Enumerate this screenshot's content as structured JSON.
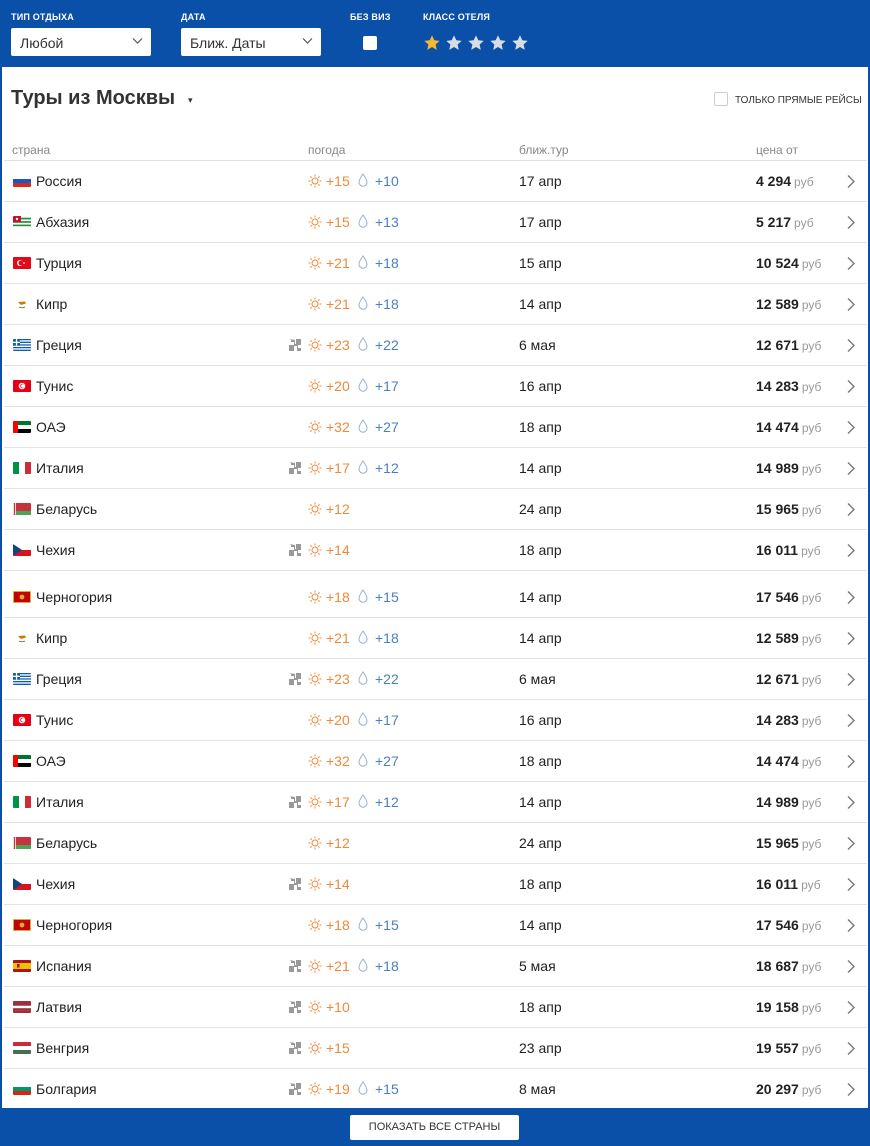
{
  "filters": {
    "type_label": "ТИП ОТДЫХА",
    "type_value": "Любой",
    "date_label": "ДАТА",
    "date_value": "Ближ. Даты",
    "novisa_label": "БЕЗ ВИЗ",
    "hotel_class_label": "КЛАСС ОТЕЛЯ",
    "hotel_stars_selected": 1,
    "hotel_stars_total": 5,
    "star_active_color": "#f5b82e",
    "star_inactive_color": "#d9dde3"
  },
  "header": {
    "title": "Туры из Москвы",
    "caret": "▾",
    "direct_flights_label": "ТОЛЬКО ПРЯМЫЕ РЕЙСЫ"
  },
  "table": {
    "columns": {
      "country": "страна",
      "weather": "погода",
      "nearest": "ближ.тур",
      "price": "цена от"
    },
    "currency": "руб",
    "rows": [
      {
        "country": "Россия",
        "flag": "ru",
        "visa": false,
        "air": "+15",
        "water": "+10",
        "date": "17 апр",
        "price": "4 294"
      },
      {
        "country": "Абхазия",
        "flag": "abkhazia",
        "visa": false,
        "air": "+15",
        "water": "+13",
        "date": "17 апр",
        "price": "5 217"
      },
      {
        "country": "Турция",
        "flag": "tr",
        "visa": false,
        "air": "+21",
        "water": "+18",
        "date": "15 апр",
        "price": "10 524"
      },
      {
        "country": "Кипр",
        "flag": "cy",
        "visa": false,
        "air": "+21",
        "water": "+18",
        "date": "14 апр",
        "price": "12 589"
      },
      {
        "country": "Греция",
        "flag": "gr",
        "visa": true,
        "air": "+23",
        "water": "+22",
        "date": "6 мая",
        "price": "12 671"
      },
      {
        "country": "Тунис",
        "flag": "tn",
        "visa": false,
        "air": "+20",
        "water": "+17",
        "date": "16 апр",
        "price": "14 283"
      },
      {
        "country": "ОАЭ",
        "flag": "ae",
        "visa": false,
        "air": "+32",
        "water": "+27",
        "date": "18 апр",
        "price": "14 474"
      },
      {
        "country": "Италия",
        "flag": "it",
        "visa": true,
        "air": "+17",
        "water": "+12",
        "date": "14 апр",
        "price": "14 989"
      },
      {
        "country": "Беларусь",
        "flag": "by",
        "visa": false,
        "air": "+12",
        "water": "",
        "date": "24 апр",
        "price": "15 965"
      },
      {
        "country": "Чехия",
        "flag": "cz",
        "visa": true,
        "air": "+14",
        "water": "",
        "date": "18 апр",
        "price": "16 011"
      },
      {
        "country": "Черногория",
        "flag": "me",
        "visa": false,
        "air": "+18",
        "water": "+15",
        "date": "14 апр",
        "price": "17 546",
        "tall": true
      },
      {
        "country": "Кипр",
        "flag": "cy",
        "visa": false,
        "air": "+21",
        "water": "+18",
        "date": "14 апр",
        "price": "12 589"
      },
      {
        "country": "Греция",
        "flag": "gr",
        "visa": true,
        "air": "+23",
        "water": "+22",
        "date": "6 мая",
        "price": "12 671"
      },
      {
        "country": "Тунис",
        "flag": "tn",
        "visa": false,
        "air": "+20",
        "water": "+17",
        "date": "16 апр",
        "price": "14 283"
      },
      {
        "country": "ОАЭ",
        "flag": "ae",
        "visa": false,
        "air": "+32",
        "water": "+27",
        "date": "18 апр",
        "price": "14 474"
      },
      {
        "country": "Италия",
        "flag": "it",
        "visa": true,
        "air": "+17",
        "water": "+12",
        "date": "14 апр",
        "price": "14 989"
      },
      {
        "country": "Беларусь",
        "flag": "by",
        "visa": false,
        "air": "+12",
        "water": "",
        "date": "24 апр",
        "price": "15 965"
      },
      {
        "country": "Чехия",
        "flag": "cz",
        "visa": true,
        "air": "+14",
        "water": "",
        "date": "18 апр",
        "price": "16 011"
      },
      {
        "country": "Черногория",
        "flag": "me",
        "visa": false,
        "air": "+18",
        "water": "+15",
        "date": "14 апр",
        "price": "17 546"
      },
      {
        "country": "Испания",
        "flag": "es",
        "visa": true,
        "air": "+21",
        "water": "+18",
        "date": "5 мая",
        "price": "18 687"
      },
      {
        "country": "Латвия",
        "flag": "lv",
        "visa": true,
        "air": "+10",
        "water": "",
        "date": "18 апр",
        "price": "19 158"
      },
      {
        "country": "Венгрия",
        "flag": "hu",
        "visa": true,
        "air": "+15",
        "water": "",
        "date": "23 апр",
        "price": "19 557"
      },
      {
        "country": "Болгария",
        "flag": "bg",
        "visa": true,
        "air": "+19",
        "water": "+15",
        "date": "8 мая",
        "price": "20 297"
      }
    ]
  },
  "footer": {
    "show_all_label": "ПОКАЗАТЬ ВСЕ СТРАНЫ"
  },
  "colors": {
    "brand_blue": "#0a50a8",
    "air_temp": "#f0883a",
    "water_temp": "#4a7fc4"
  }
}
